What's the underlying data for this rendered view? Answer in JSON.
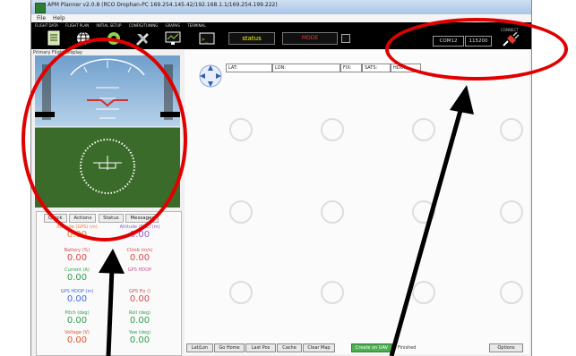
{
  "window": {
    "title": "APM Planner v2.0.8 (RCO Drophan-PC 169.254.145.42/192.168.1.1/169.254.199.222)"
  },
  "menu": [
    "File",
    "Help"
  ],
  "toolbar": {
    "tabs": [
      "FLIGHT DATA",
      "FLIGHT PLAN",
      "INITIAL SETUP",
      "CONFIG/TUNING",
      "GRAPHS",
      "TERMINAL"
    ],
    "status_label": "status",
    "mode_label": "MODE",
    "connect_label": "CONNECT",
    "com_port": "COM12",
    "baud": "115200"
  },
  "hud": {
    "title": "Primary Flight Display"
  },
  "quick": {
    "tabs": [
      "Quick",
      "Actions",
      "Status",
      "Messages"
    ],
    "items": [
      {
        "label": "Altitude (GPS) (m)",
        "value": "0.00",
        "color": "#f07d3c"
      },
      {
        "label": "Altitude (REL) (m)",
        "value": "0.00",
        "color": "#8e5cd6"
      },
      {
        "label": "Battery (%)",
        "value": "0.00",
        "color": "#d94a4a"
      },
      {
        "label": "Climb (m/s)",
        "value": "0.00",
        "color": "#d94a4a"
      },
      {
        "label": "Current (A)",
        "value": "0.00",
        "color": "#2e9d4c"
      },
      {
        "label": "GPS HDOP",
        "value": "",
        "color": "#c85090"
      },
      {
        "label": "GPS HDOP (m)",
        "value": "0.00",
        "color": "#3f6ce0"
      },
      {
        "label": "GPS Fix ()",
        "value": "0.00",
        "color": "#d94a4a"
      },
      {
        "label": "Pitch (deg)",
        "value": "0.00",
        "color": "#2e9d4c"
      },
      {
        "label": "Roll (deg)",
        "value": "0.00",
        "color": "#2e9d4c"
      },
      {
        "label": "Voltage (V)",
        "value": "0.00",
        "color": "#e0532b"
      },
      {
        "label": "Yaw (deg)",
        "value": "0.00",
        "color": "#2e9d4c"
      }
    ]
  },
  "map": {
    "fields": {
      "lat": "LAT:",
      "lon": "LON:",
      "fix": "FIX:",
      "sats": "SATS:",
      "hdop": "HDOP:"
    },
    "buttons": {
      "latlon": "Lat/Lon",
      "go_home": "Go Home",
      "last_pos": "Last Pos",
      "cache": "Cache",
      "clear_map": "Clear Map",
      "create_wp": "Create on UAV"
    },
    "status": "Finished",
    "options": "Options"
  },
  "colors": {
    "annotation": "#e00000",
    "toolbar": "#000000",
    "hud_ground": "#3b6b2a",
    "hud_sky": "#8ab4d8",
    "status_text": "#ffff00"
  }
}
